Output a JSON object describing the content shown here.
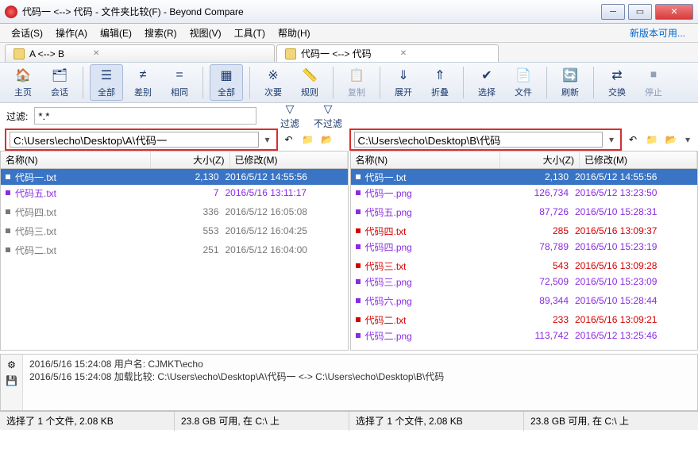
{
  "title": "代码一 <--> 代码 - 文件夹比较(F) - Beyond Compare",
  "menu": [
    "会话(S)",
    "操作(A)",
    "编辑(E)",
    "搜索(R)",
    "视图(V)",
    "工具(T)",
    "帮助(H)"
  ],
  "new_version": "新版本可用...",
  "tabs": [
    {
      "label": "A <--> B"
    },
    {
      "label": "代码一 <--> 代码"
    }
  ],
  "toolbar": {
    "home": "主页",
    "session": "会话",
    "all": "全部",
    "diff": "差别",
    "same": "相同",
    "all2": "全部",
    "minor": "次要",
    "rules": "规则",
    "copy": "复制",
    "expand": "展开",
    "collapse": "折叠",
    "select": "选择",
    "files": "文件",
    "refresh": "刷新",
    "swap": "交换",
    "stop": "停止"
  },
  "filter": {
    "label": "过滤:",
    "value": "*.*",
    "btn_filter": "过滤",
    "btn_nofilter": "不过滤"
  },
  "paths": {
    "left": "C:\\Users\\echo\\Desktop\\A\\代码一",
    "right": "C:\\Users\\echo\\Desktop\\B\\代码"
  },
  "columns": {
    "name": "名称(N)",
    "size": "大小(Z)",
    "modified": "已修改(M)"
  },
  "left_files": [
    {
      "name": "代码一.txt",
      "size": "2,130",
      "date": "2016/5/12 14:55:56",
      "cls": "black",
      "sel": true
    },
    {
      "name": "代码五.txt",
      "size": "7",
      "date": "2016/5/16 13:11:17",
      "cls": "purple"
    },
    {
      "name": "代码四.txt",
      "size": "336",
      "date": "2016/5/12 16:05:08",
      "cls": "gray"
    },
    {
      "name": "代码三.txt",
      "size": "553",
      "date": "2016/5/12 16:04:25",
      "cls": "gray"
    },
    {
      "name": "代码二.txt",
      "size": "251",
      "date": "2016/5/12 16:04:00",
      "cls": "gray"
    }
  ],
  "right_files": [
    {
      "name": "代码一.txt",
      "size": "2,130",
      "date": "2016/5/12 14:55:56",
      "cls": "black",
      "sel": true
    },
    {
      "name": "代码一.png",
      "size": "126,734",
      "date": "2016/5/12 13:23:50",
      "cls": "purple"
    },
    {
      "name": "代码五.png",
      "size": "87,726",
      "date": "2016/5/10 15:28:31",
      "cls": "purple"
    },
    {
      "name": "代码四.txt",
      "size": "285",
      "date": "2016/5/16 13:09:37",
      "cls": "red"
    },
    {
      "name": "代码四.png",
      "size": "78,789",
      "date": "2016/5/10 15:23:19",
      "cls": "purple"
    },
    {
      "name": "代码三.txt",
      "size": "543",
      "date": "2016/5/16 13:09:28",
      "cls": "red"
    },
    {
      "name": "代码三.png",
      "size": "72,509",
      "date": "2016/5/10 15:23:09",
      "cls": "purple"
    },
    {
      "name": "代码六.png",
      "size": "89,344",
      "date": "2016/5/10 15:28:44",
      "cls": "purple"
    },
    {
      "name": "代码二.txt",
      "size": "233",
      "date": "2016/5/16 13:09:21",
      "cls": "red"
    },
    {
      "name": "代码二.png",
      "size": "113,742",
      "date": "2016/5/12 13:25:46",
      "cls": "purple"
    }
  ],
  "log": [
    "2016/5/16 15:24:08  用户名: CJMKT\\echo",
    "2016/5/16 15:24:08  加载比较: C:\\Users\\echo\\Desktop\\A\\代码一 <-> C:\\Users\\echo\\Desktop\\B\\代码"
  ],
  "status": {
    "l1": "选择了 1 个文件, 2.08 KB",
    "l2": "23.8 GB 可用, 在 C:\\ 上",
    "r1": "选择了 1 个文件, 2.08 KB",
    "r2": "23.8 GB 可用, 在 C:\\ 上"
  }
}
